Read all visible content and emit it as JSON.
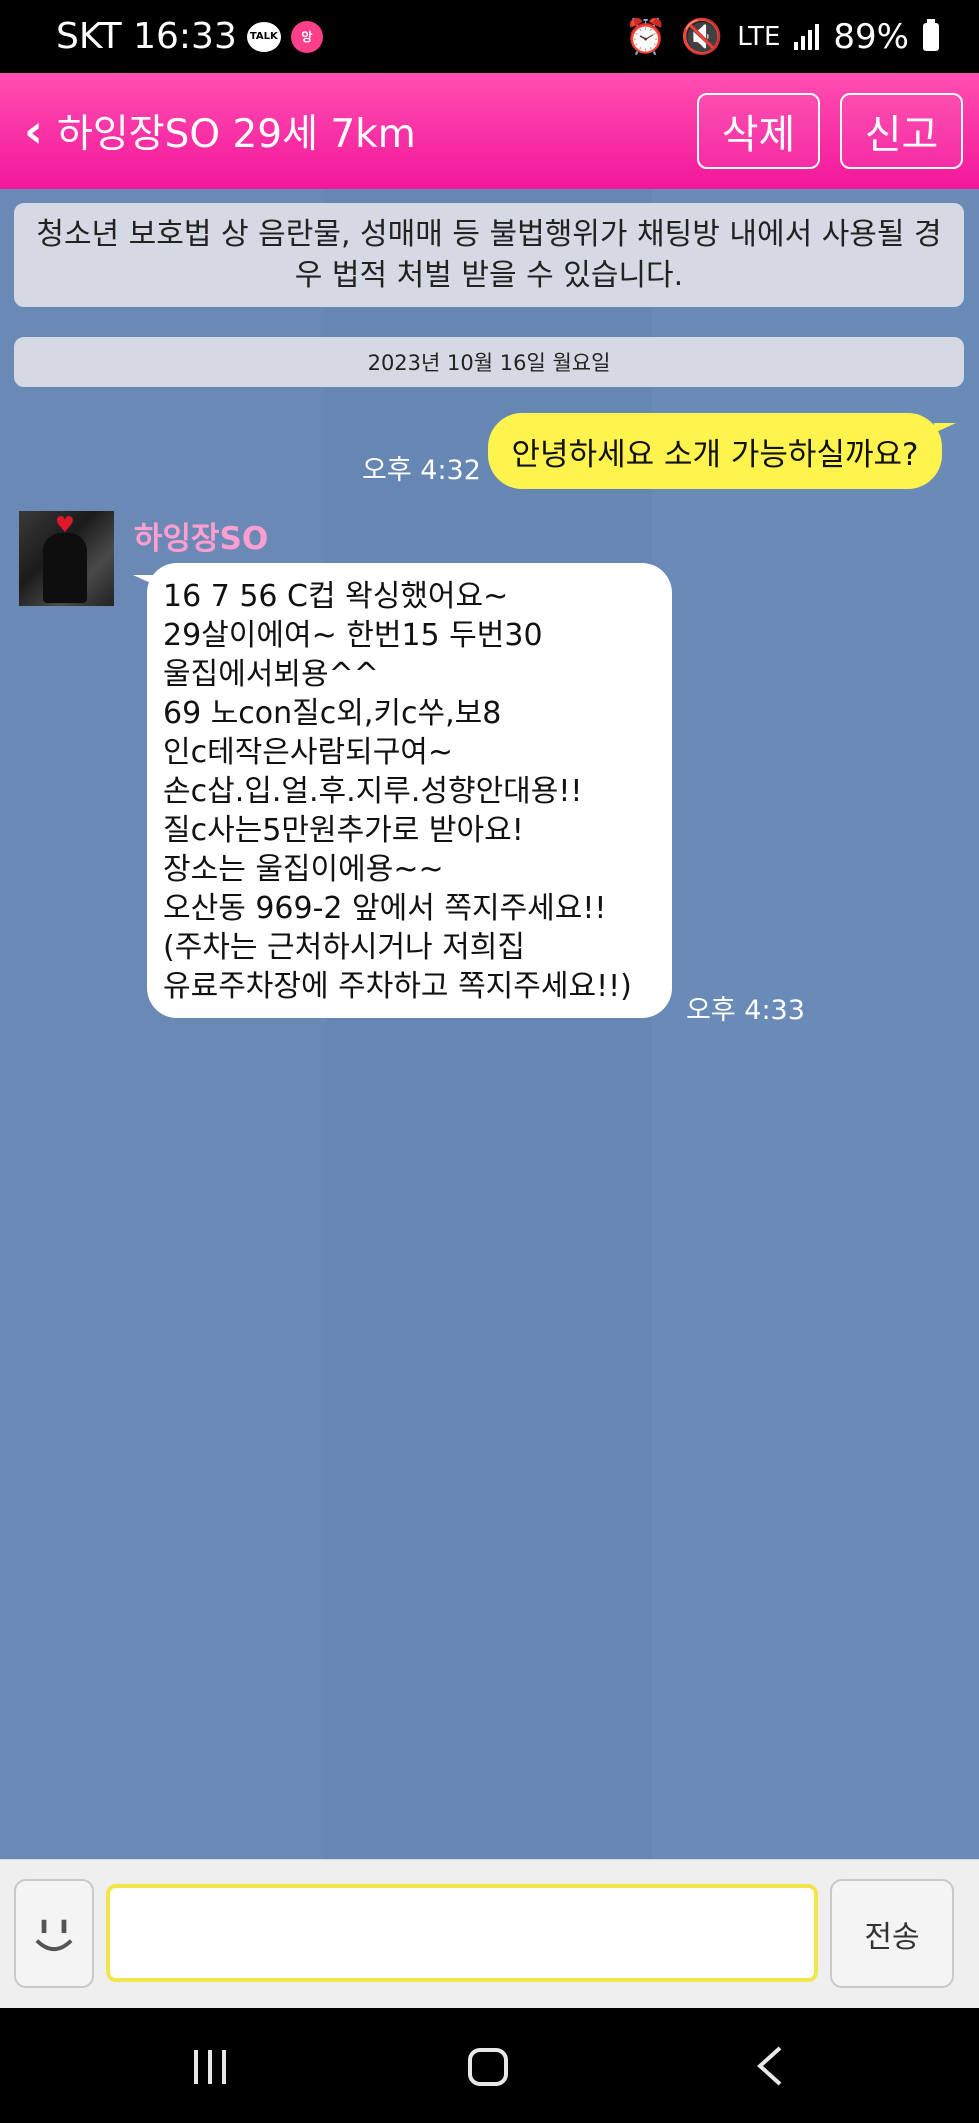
{
  "status_bar": {
    "carrier_time": "SKT 16:33",
    "talk_icon_text": "TALK",
    "pink_icon_text": "앙",
    "network": "LTE",
    "battery": "89%"
  },
  "header": {
    "title": "하잉장SO 29세 7km",
    "delete_label": "삭제",
    "report_label": "신고"
  },
  "chat": {
    "notice": "청소년 보호법 상 음란물, 성매매 등 불법행위가 채팅방 내에서 사용될 경우 법적 처벌 받을 수 있습니다.",
    "date": "2023년 10월 16일 월요일",
    "messages": [
      {
        "from": "me",
        "text": "안녕하세요 소개 가능하실까요?",
        "time": "오후 4:32"
      },
      {
        "from": "other",
        "sender": "하잉장SO",
        "lines": [
          "16 7 56 C컵 왁싱했어요~",
          "29살이에여~ 한번15 두번30",
          "울집에서뵈용^^",
          "69 노con질c외,키c쑤,보8",
          "인c테작은사람되구여~",
          "손c삽.입.얼.후.지루.성향안대용!!",
          "질c사는5만원추가로 받아요!",
          "장소는 울집이에용~~",
          "오산동 969-2 앞에서 쪽지주세요!!",
          "(주차는 근처하시거나 저희집",
          "유료주차장에 주차하고 쪽지주세요!!)"
        ],
        "time": "오후 4:33"
      }
    ]
  },
  "input": {
    "value": "",
    "send_label": "전송"
  }
}
